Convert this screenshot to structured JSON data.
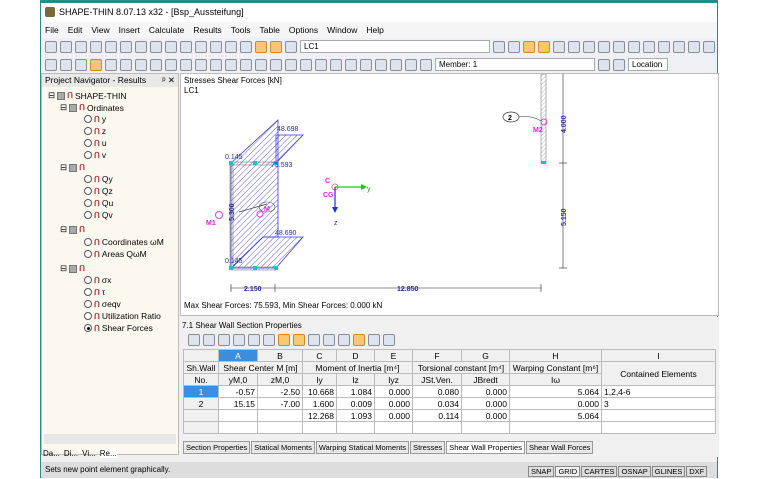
{
  "title": "SHAPE-THIN 8.07.13 x32 - [Bsp_Aussteifung]",
  "menu": [
    "File",
    "Edit",
    "View",
    "Insert",
    "Calculate",
    "Results",
    "Tools",
    "Table",
    "Options",
    "Window",
    "Help"
  ],
  "toolbar": {
    "load_case": "LC1",
    "member": "Member: 1",
    "location": "Location"
  },
  "navigator": {
    "title": "Project Navigator - Results",
    "root": "SHAPE-THIN",
    "groups": [
      {
        "label": "Ordinates",
        "items": [
          "y",
          "z",
          "u",
          "v"
        ]
      },
      {
        "label": "",
        "items": [
          "Qy",
          "Qz",
          "Qu",
          "Qv"
        ]
      },
      {
        "label": "",
        "items": [
          "Coordinates ωM",
          "Areas QωM"
        ]
      },
      {
        "label": "",
        "items": [
          "σx",
          "τ",
          "σeqv",
          "Utilization Ratio",
          "Shear Forces"
        ]
      }
    ],
    "selected": "Shear Forces",
    "tabs": [
      "Da...",
      "Di...",
      "Vi...",
      "Re..."
    ]
  },
  "view": {
    "title": "Stresses Shear Forces [kN]",
    "load_case": "LC1",
    "footer": "Max Shear Forces: 75.593, Min Shear Forces: 0.000 kN",
    "labels": {
      "v1": "48.698",
      "v2": "0.145",
      "v3": "75.593",
      "v4": "48.690",
      "v5": "0.145",
      "dim_web": "5.300",
      "M": "M",
      "M1": "M1",
      "M2": "M2",
      "C": "C",
      "CG": "CG",
      "y": "y",
      "z": "z",
      "wall2": "2",
      "d1": "2.150",
      "d2": "12.850",
      "d3": "4.000",
      "d4": "5.150"
    }
  },
  "table": {
    "title": "7.1 Shear Wall Section Properties",
    "letters": [
      "A",
      "B",
      "C",
      "D",
      "E",
      "F",
      "G",
      "H",
      "I"
    ],
    "h1": [
      "Sh.Wall",
      "Shear Center M [m]",
      "Moment of Inertia [m⁴]",
      "Torsional constant [m⁴]",
      "Warping Constant [m⁶]",
      ""
    ],
    "h2": [
      "No.",
      "yM,0",
      "zM,0",
      "Iy",
      "Iz",
      "Iyz",
      "JSt.Ven.",
      "JBredt",
      "Iω",
      "Contained Elements"
    ],
    "rows": [
      [
        "1",
        "-0.57",
        "-2.50",
        "10.668",
        "1.084",
        "0.000",
        "0.080",
        "0.000",
        "5.064",
        "1,2,4-6"
      ],
      [
        "2",
        "15.15",
        "-7.00",
        "1.600",
        "0.009",
        "0.000",
        "0.034",
        "0.000",
        "0.000",
        "3"
      ],
      [
        "",
        "",
        "",
        "12.268",
        "1.093",
        "0.000",
        "0.114",
        "0.000",
        "5.064",
        ""
      ]
    ],
    "tabs": [
      "Section Properties",
      "Statical Moments",
      "Warping Statical Moments",
      "Stresses",
      "Shear Wall Properties",
      "Shear Wall Forces"
    ],
    "active_tab": "Shear Wall Properties"
  },
  "status": {
    "text": "Sets new point element graphically.",
    "buttons": [
      "SNAP",
      "GRID",
      "CARTES",
      "OSNAP",
      "GLINES",
      "DXF"
    ]
  }
}
